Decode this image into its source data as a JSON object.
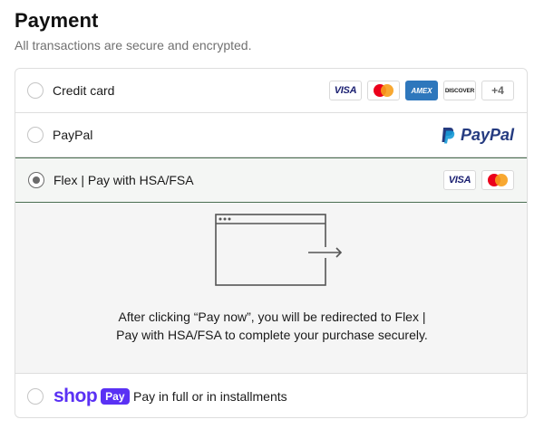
{
  "header": {
    "title": "Payment",
    "subtitle": "All transactions are secure and encrypted."
  },
  "methods": {
    "credit_card": {
      "label": "Credit card",
      "cards": [
        "VISA",
        "AMEX",
        "DISCOVER"
      ],
      "more": "+4"
    },
    "paypal": {
      "label": "PayPal",
      "logo_text": "PayPal"
    },
    "flex": {
      "label": "Flex | Pay with HSA/FSA",
      "selected": true,
      "cards": [
        "VISA"
      ],
      "info": "After clicking “Pay now”, you will be redirected to Flex | Pay with HSA/FSA to complete your purchase securely."
    },
    "shop_pay": {
      "logo_word": "shop",
      "logo_badge": "Pay",
      "label": "Pay in full or in installments"
    }
  },
  "icons": {
    "radio": "radio-icon",
    "mastercard": "mastercard-icon",
    "paypal_mark": "paypal-mark-icon",
    "redirect": "browser-redirect-icon"
  },
  "colors": {
    "selected_border": "#4b6f52",
    "shop_purple": "#5a31f4",
    "paypal_blue": "#253b80",
    "amex_blue": "#2e77bc"
  }
}
